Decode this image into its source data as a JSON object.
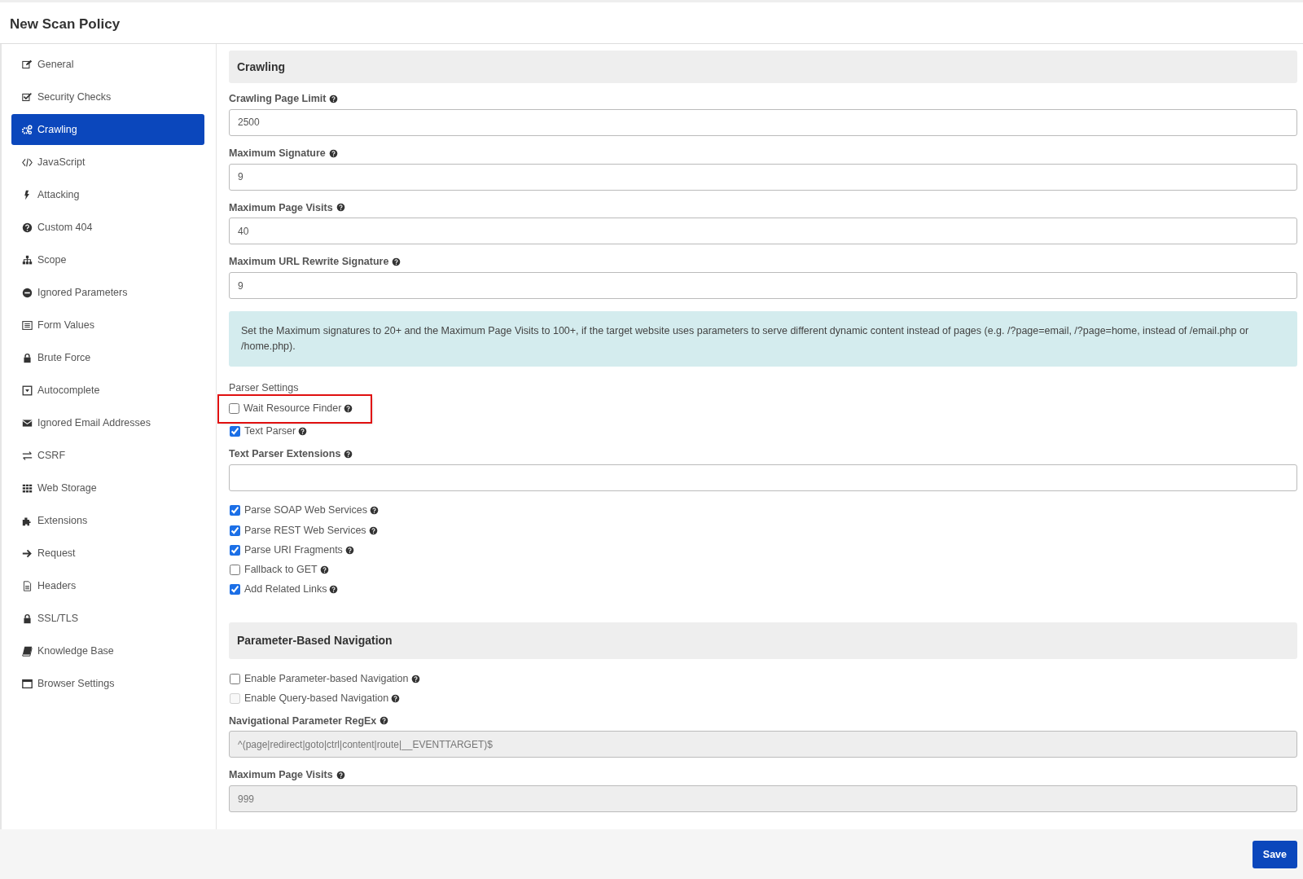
{
  "window": {
    "title": "New Scan Policy"
  },
  "sidebar": {
    "items": [
      {
        "label": "General",
        "selected": false
      },
      {
        "label": "Security Checks",
        "selected": false
      },
      {
        "label": "Crawling",
        "selected": true
      },
      {
        "label": "JavaScript",
        "selected": false
      },
      {
        "label": "Attacking",
        "selected": false
      },
      {
        "label": "Custom 404",
        "selected": false
      },
      {
        "label": "Scope",
        "selected": false
      },
      {
        "label": "Ignored Parameters",
        "selected": false
      },
      {
        "label": "Form Values",
        "selected": false
      },
      {
        "label": "Brute Force",
        "selected": false
      },
      {
        "label": "Autocomplete",
        "selected": false
      },
      {
        "label": "Ignored Email Addresses",
        "selected": false
      },
      {
        "label": "CSRF",
        "selected": false
      },
      {
        "label": "Web Storage",
        "selected": false
      },
      {
        "label": "Extensions",
        "selected": false
      },
      {
        "label": "Request",
        "selected": false
      },
      {
        "label": "Headers",
        "selected": false
      },
      {
        "label": "SSL/TLS",
        "selected": false
      },
      {
        "label": "Knowledge Base",
        "selected": false
      },
      {
        "label": "Browser Settings",
        "selected": false
      }
    ]
  },
  "content": [
    {
      "kind": "section",
      "title": "Crawling"
    },
    {
      "kind": "field",
      "label": "Crawling Page Limit",
      "value": "2500",
      "disabled": false
    },
    {
      "kind": "field",
      "label": "Maximum Signature",
      "value": "9",
      "disabled": false
    },
    {
      "kind": "field",
      "label": "Maximum Page Visits",
      "value": "40",
      "disabled": false
    },
    {
      "kind": "field",
      "label": "Maximum URL Rewrite Signature",
      "value": "9",
      "disabled": false
    },
    {
      "kind": "alert",
      "text": "Set the Maximum signatures to 20+ and the Maximum Page Visits to 100+, if the target website uses parameters to serve different dynamic content instead of pages (e.g. /?page=email, /?page=home, instead of /email.php or /home.php)."
    },
    {
      "kind": "caption",
      "text": "Parser Settings"
    },
    {
      "kind": "checkbox",
      "label": "Wait Resource Finder",
      "checked": false,
      "disabled": false,
      "highlighted": true
    },
    {
      "kind": "checkbox",
      "label": "Text Parser",
      "checked": true,
      "disabled": false
    },
    {
      "kind": "field",
      "label": "Text Parser Extensions",
      "disabled": false
    },
    {
      "kind": "checkbox",
      "label": "Parse SOAP Web Services",
      "checked": true,
      "disabled": false
    },
    {
      "kind": "checkbox",
      "label": "Parse REST Web Services",
      "checked": true,
      "disabled": false
    },
    {
      "kind": "checkbox",
      "label": "Parse URI Fragments",
      "checked": true,
      "disabled": false
    },
    {
      "kind": "checkbox",
      "label": "Fallback to GET",
      "checked": false,
      "disabled": false
    },
    {
      "kind": "checkbox",
      "label": "Add Related Links",
      "checked": true,
      "disabled": false
    },
    {
      "kind": "section",
      "title": "Parameter-Based Navigation"
    },
    {
      "kind": "checkbox",
      "label": "Enable Parameter-based Navigation",
      "checked": false,
      "disabled": false
    },
    {
      "kind": "checkbox",
      "label": "Enable Query-based Navigation",
      "checked": false,
      "disabled": true
    },
    {
      "kind": "field",
      "label": "Navigational Parameter RegEx",
      "value": "^(page|redirect|goto|ctrl|content|route|__EVENTTARGET)$",
      "disabled": true
    },
    {
      "kind": "field",
      "label": "Maximum Page Visits",
      "value": "999",
      "disabled": true
    }
  ],
  "footer": {
    "save_button": "Save"
  }
}
